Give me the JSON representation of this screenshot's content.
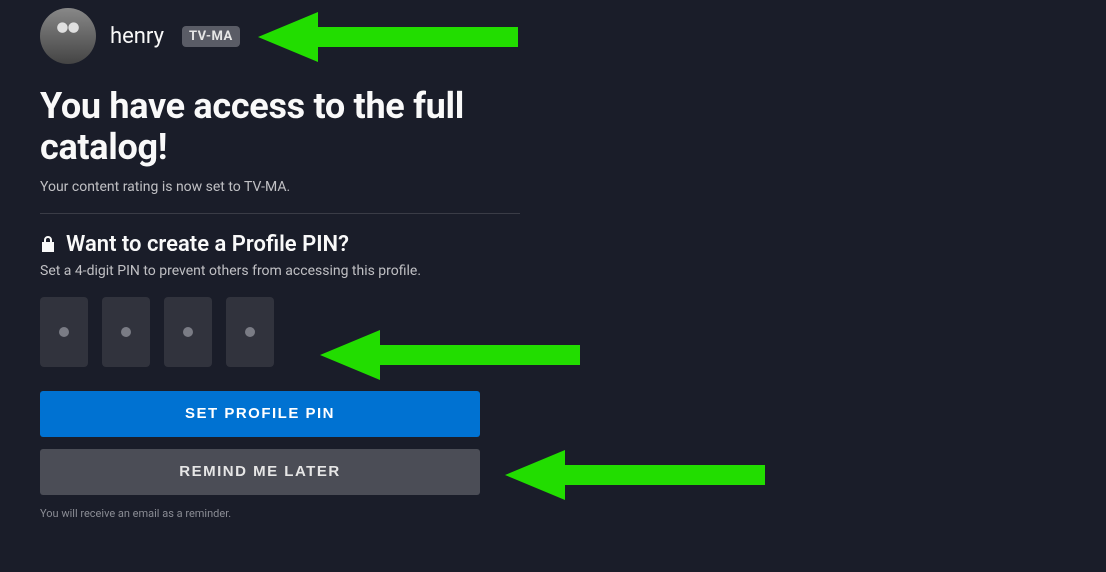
{
  "profile": {
    "name": "henry",
    "rating_badge": "TV-MA"
  },
  "headline": "You have access to the full catalog!",
  "subtext": "Your content rating is now set to TV-MA.",
  "pin_section": {
    "heading": "Want to create a Profile PIN?",
    "description": "Set a 4-digit PIN to prevent others from accessing this profile."
  },
  "buttons": {
    "set_pin": "SET PROFILE PIN",
    "remind_later": "REMIND ME LATER"
  },
  "footer_note": "You will receive an email as a reminder.",
  "annotations": {
    "arrow_color": "#22dd00"
  }
}
